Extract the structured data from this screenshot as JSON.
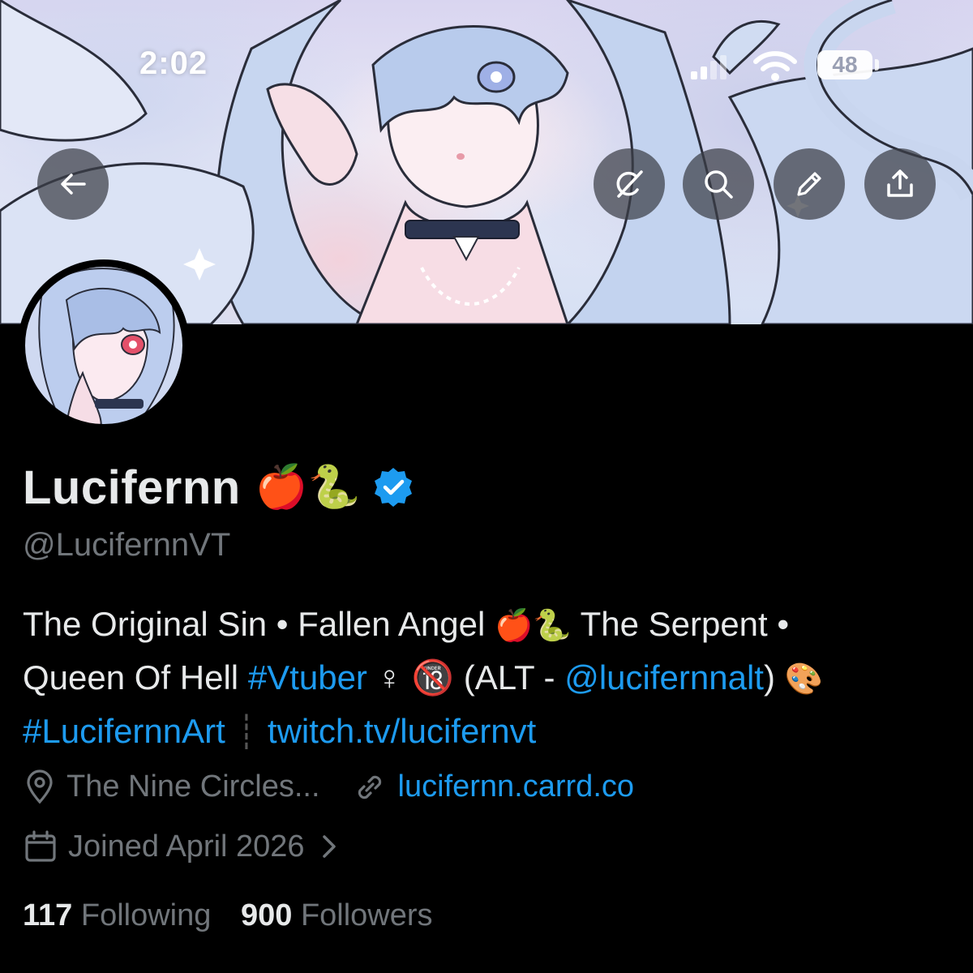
{
  "status_bar": {
    "time": "2:02",
    "battery": "48"
  },
  "nav": {
    "back_icon": "arrow-left-icon",
    "actions": [
      "grok-icon",
      "search-icon",
      "edit-icon",
      "share-icon"
    ]
  },
  "profile": {
    "display_name": "Lucifernn",
    "name_emoji": "🍎🐍",
    "verified": true,
    "handle": "@LucifernnVT",
    "bio": {
      "line1_text": "The Original Sin • Fallen Angel ",
      "line1_emoji": "🍎🐍",
      "line1_tail": " The Serpent •",
      "line2_start": "Queen Of Hell ",
      "line2_hashtag": "#Vtuber",
      "line2_symbols": " ♀ 🔞 ",
      "line2_alt_pre": "(ALT - ",
      "line2_mention": "@lucifernnalt",
      "line2_alt_post": ") ",
      "line2_emoji": "🎨",
      "line3_hashtag": "#LucifernnArt",
      "line3_separator": "┊",
      "line3_link": "twitch.tv/lucifernvt"
    },
    "location": "The Nine Circles...",
    "website": "lucifernn.carrd.co",
    "joined": "Joined April 2026",
    "following_count": "117",
    "following_label": "Following",
    "followers_count": "900",
    "followers_label": "Followers"
  },
  "colors": {
    "background": "#000000",
    "text_primary": "#e7e9ea",
    "text_secondary": "#71767b",
    "link": "#1d9bf0",
    "verified_badge": "#1d9bf0"
  }
}
